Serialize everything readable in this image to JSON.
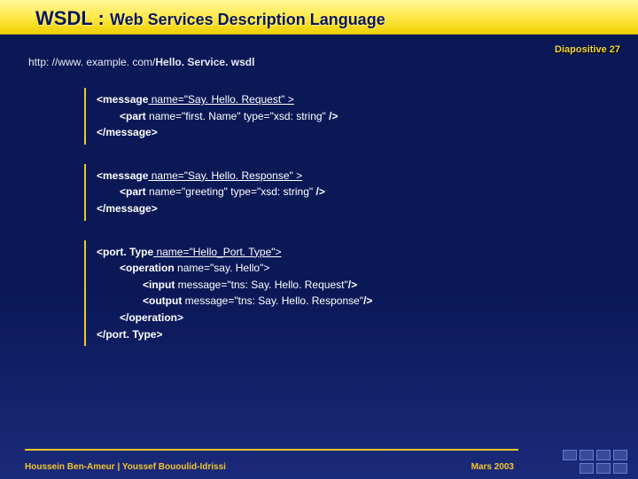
{
  "header": {
    "title_main": "WSDL :",
    "title_sub": "Web Services Description Language"
  },
  "slide_number": "Diapositive 27",
  "url_prefix": "http: //www. example. com/",
  "url_bold": "Hello. Service. wsdl",
  "block1": {
    "l1a": "<message",
    "l1b": " name=\"Say. Hello. Request\" >",
    "l2a": "<part",
    "l2b": " name=\"first. Name\" type=\"xsd: string\" ",
    "l2c": "/>",
    "l3": "</message>"
  },
  "block2": {
    "l1a": "<message",
    "l1b": " name=\"Say. Hello. Response\" >",
    "l2a": "<part",
    "l2b": " name=\"greeting\" type=\"xsd: string\" ",
    "l2c": "/>",
    "l3": "</message>"
  },
  "block3": {
    "l1a": "<port. Type",
    "l1b": " name=\"Hello_Port. Type\">",
    "l2a": "<operation",
    "l2b": " name=\"say. Hello\">",
    "l3a": "<input",
    "l3b": " message=\"tns: Say. Hello. Request\"",
    "l3c": "/>",
    "l4a": "<output",
    "l4b": " message=\"tns: Say. Hello. Response\"",
    "l4c": "/>",
    "l5": "</operation>",
    "l6": "</port. Type>"
  },
  "footer": {
    "author": "Houssein Ben-Ameur | Youssef Bououlid-Idrissi",
    "date": "Mars 2003"
  }
}
